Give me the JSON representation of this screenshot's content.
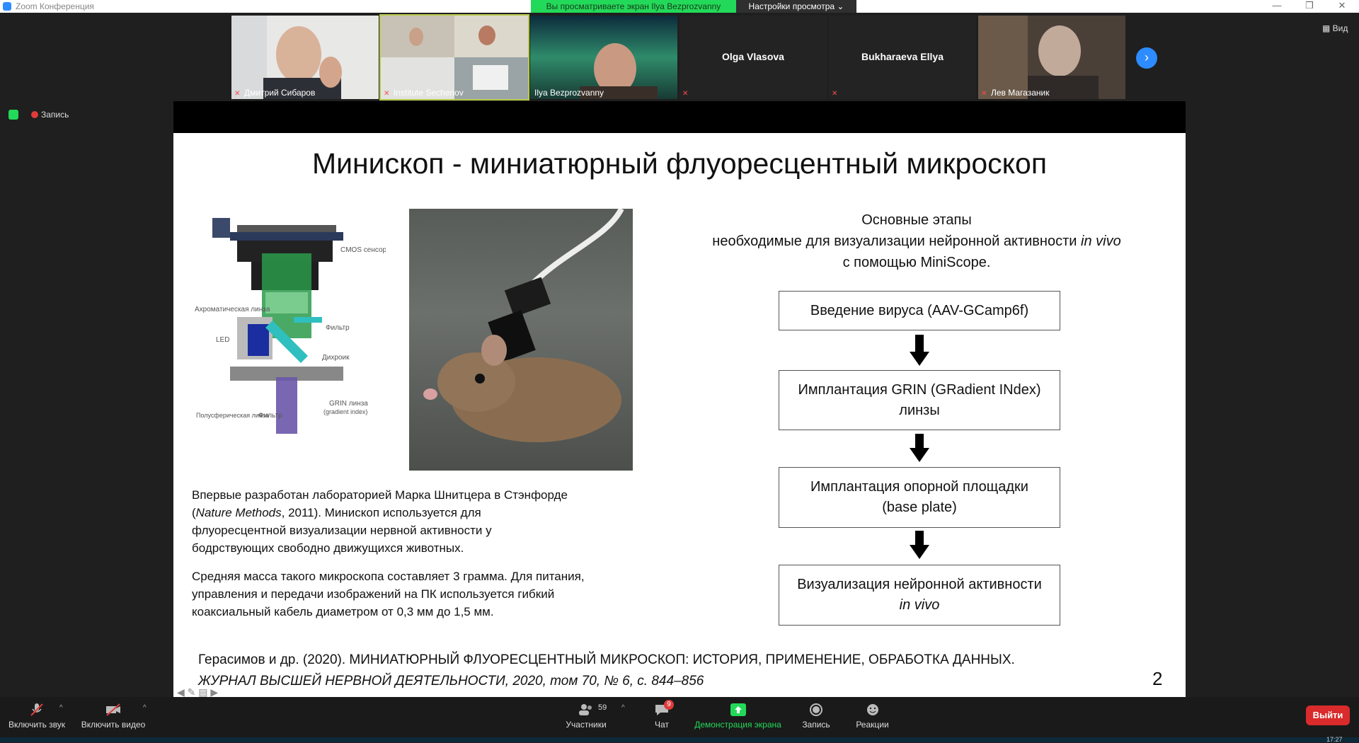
{
  "window": {
    "title": "Zoom Конференция"
  },
  "banner": {
    "sharing": "Вы просматриваете экран Ilya Bezprozvanny",
    "view_settings": "Настройки просмотра ⌄"
  },
  "window_controls": {
    "minimize": "—",
    "restore": "❐",
    "close": "✕"
  },
  "participants": [
    {
      "name": "Дмитрий Сибаров",
      "video": true
    },
    {
      "name": "Institute Sechenov",
      "video": true,
      "active": true
    },
    {
      "name": "Ilya Bezprozvanny",
      "video": true
    },
    {
      "name": "Olga Vlasova",
      "video": false
    },
    {
      "name": "Bukharaeva Ellya",
      "video": false
    },
    {
      "name": "Лев Магазаник",
      "video": true
    }
  ],
  "view_button": "Вид",
  "recording_label": "Запись",
  "slide": {
    "title": "Минископ - миниатюрный флуоресцентный микроскоп",
    "diagram_labels": {
      "cmos": "CMOS сенсор",
      "achromatic": "Ахроматическая линза",
      "filter": "Фильтр",
      "led": "LED",
      "dichroic": "Дихроик",
      "hemispherical": "Полусферическая линза",
      "filter2": "Фильтр",
      "grin": "GRIN линза",
      "grin_sub": "(gradient index)"
    },
    "desc1_line1": "Впервые разработан лабораторией Марка Шнитцера в Стэнфорде",
    "desc1_journal": "Nature Methods",
    "desc1_line2_rest": ", 2011). Минископ используется для",
    "desc1_line3": "флуоресцентной визуализации нервной активности у",
    "desc1_line4": "бодрствующих свободно движущихся животных.",
    "desc2": "Средняя масса такого микроскопа составляет 3 грамма. Для питания, управления и передачи изображений на ПК используется гибкий коаксиальный кабель диаметром от 0,3 мм до 1,5 мм.",
    "stages_title": "Основные этапы",
    "stages_sub1": "необходимые для визуализации нейронной активности",
    "stages_sub1_italic": "in vivo",
    "stages_sub2": "с помощью MiniScope.",
    "steps": [
      {
        "line1": "Введение вируса (AAV-GCamp6f)",
        "line2": ""
      },
      {
        "line1": "Имплантация GRIN (GRadient INdex)",
        "line2": "линзы"
      },
      {
        "line1": "Имплантация опорной площадки",
        "line2": "(base plate)"
      },
      {
        "line1": "Визуализация нейронной активности",
        "line2": "in vivo"
      }
    ],
    "citation_line1": "Герасимов и др. (2020). МИНИАТЮРНЫЙ ФЛУОРЕСЦЕНТНЫЙ МИКРОСКОП: ИСТОРИЯ, ПРИМЕНЕНИЕ, ОБРАБОТКА ДАННЫХ.",
    "citation_line2": "ЖУРНАЛ ВЫСШЕЙ НЕРВНОЙ ДЕЯТЕЛЬНОСТИ, 2020, том 70, № 6, с. 844–856",
    "page_number": "2"
  },
  "toolbar": {
    "unmute": "Включить звук",
    "start_video": "Включить видео",
    "participants": "Участники",
    "participants_count": "59",
    "chat": "Чат",
    "chat_badge": "9",
    "share": "Демонстрация экрана",
    "record": "Запись",
    "reactions": "Реакции",
    "leave": "Выйти"
  },
  "clock": "17:27",
  "colors": {
    "share_green": "#23d959",
    "zoom_blue": "#2d8cff",
    "leave_red": "#d92b2b"
  }
}
